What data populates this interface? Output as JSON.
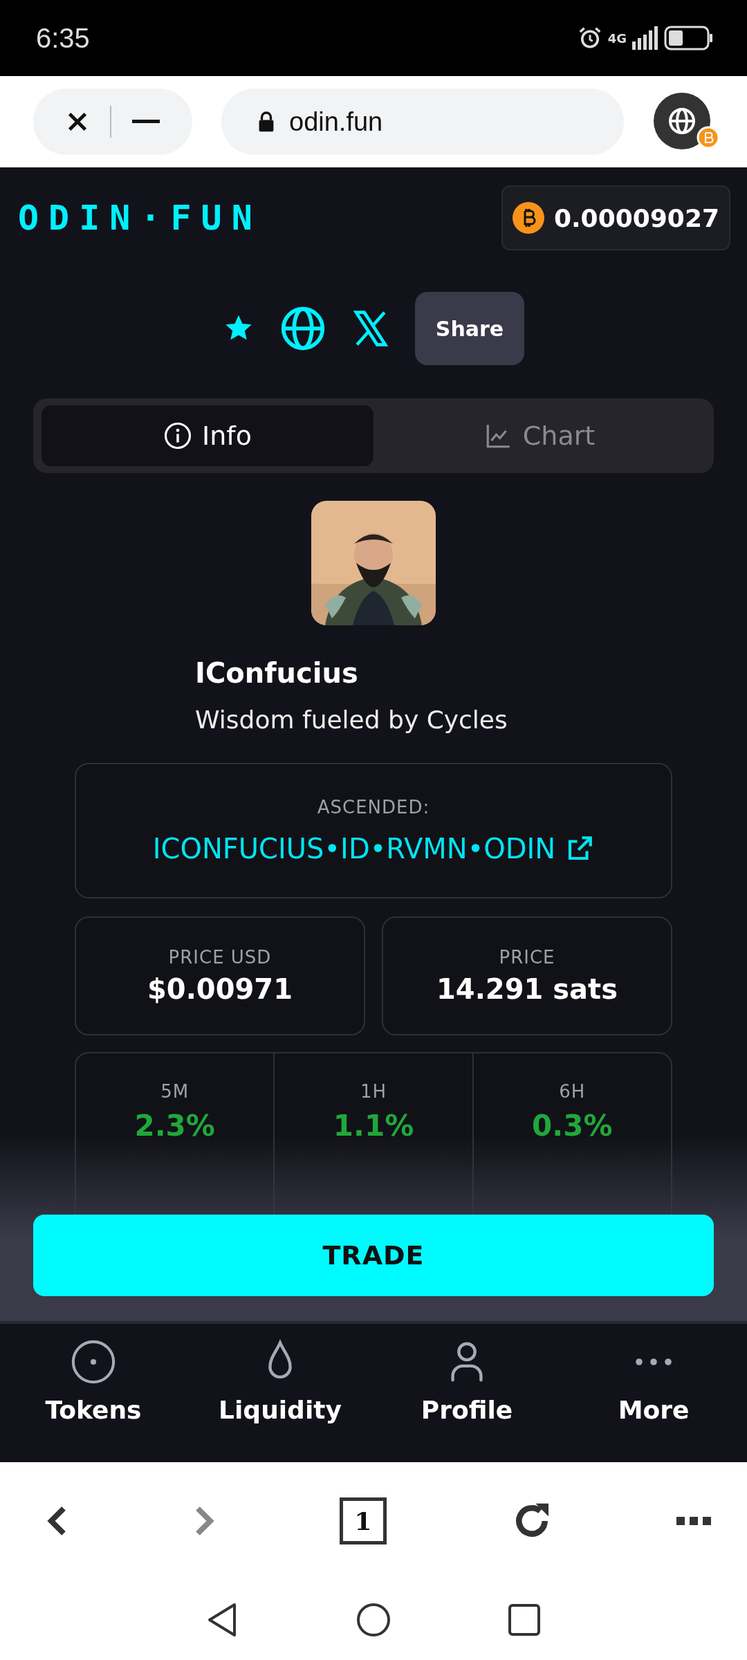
{
  "status_bar": {
    "time": "6:35",
    "network": "4G"
  },
  "browser": {
    "url": "odin.fun"
  },
  "header": {
    "logo": "ODIN·FUN",
    "balance": "0.00009027"
  },
  "actions": {
    "share": "Share"
  },
  "tabs": [
    {
      "label": "Info",
      "selected": true
    },
    {
      "label": "Chart",
      "selected": false
    }
  ],
  "token": {
    "name": "IConfucius",
    "description": "Wisdom fueled by Cycles"
  },
  "ascended": {
    "label": "ASCENDED:",
    "value": "ICONFUCIUS•ID•RVMN•ODIN"
  },
  "prices": [
    {
      "label": "PRICE USD",
      "value": "$0.00971"
    },
    {
      "label": "PRICE",
      "value": "14.291 sats"
    }
  ],
  "changes": [
    {
      "label": "5M",
      "value": "2.3%"
    },
    {
      "label": "1H",
      "value": "1.1%"
    },
    {
      "label": "6H",
      "value": "0.3%"
    }
  ],
  "trade_button": "TRADE",
  "bottom_nav": [
    {
      "label": "Tokens"
    },
    {
      "label": "Liquidity"
    },
    {
      "label": "Profile"
    },
    {
      "label": "More"
    }
  ],
  "browser_toolbar": {
    "tab_count": "1",
    "forward_enabled": false
  }
}
